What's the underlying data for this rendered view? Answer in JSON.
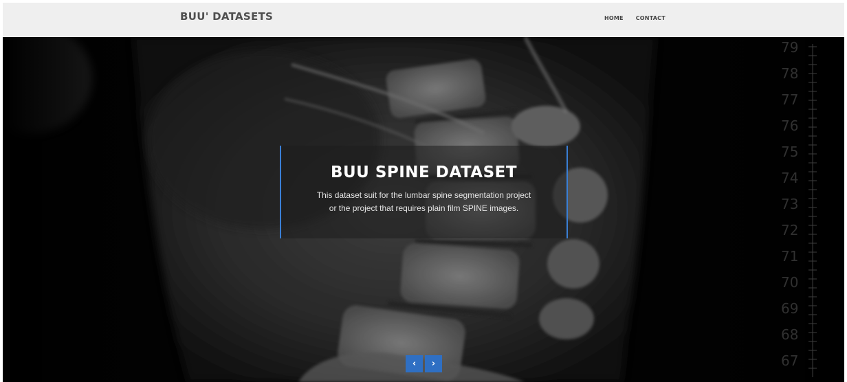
{
  "navbar": {
    "brand": "BUU' DATASETS",
    "links": [
      {
        "label": "HOME"
      },
      {
        "label": "CONTACT"
      }
    ]
  },
  "hero": {
    "title": "BUU SPINE DATASET",
    "description_line1": "This dataset suit for the lumbar spine segmentation project",
    "description_line2": "or the project that requires plain film SPINE images.",
    "ruler_numbers": [
      "79",
      "78",
      "77",
      "76",
      "75",
      "74",
      "73",
      "72",
      "71",
      "70",
      "69",
      "68",
      "67"
    ]
  },
  "carousel": {
    "prev_icon": "chevron-left-icon",
    "next_icon": "chevron-right-icon",
    "prev_glyph": "‹",
    "next_glyph": "›"
  },
  "colors": {
    "accent": "#3a7fd5",
    "button": "#2f6fc3",
    "navbar_bg": "#efefef",
    "brand_text": "#4f4f4f"
  }
}
